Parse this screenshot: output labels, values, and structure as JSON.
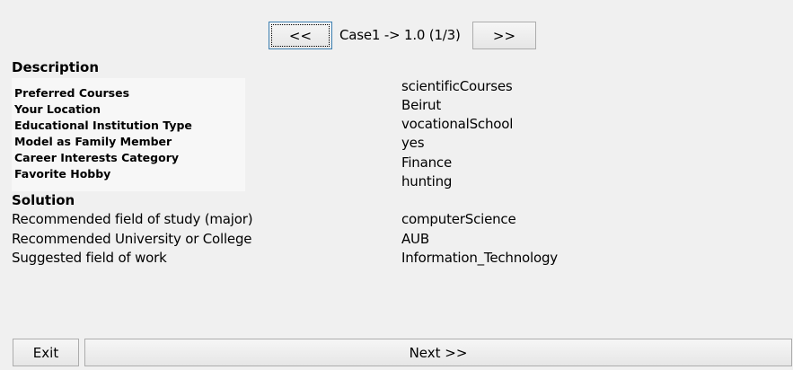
{
  "navigation": {
    "prev_label": "<<",
    "next_label": ">>",
    "case_indicator": "Case1 -> 1.0 (1/3)"
  },
  "description": {
    "title": "Description",
    "fields": [
      {
        "label": "Preferred Courses",
        "value": "scientificCourses"
      },
      {
        "label": "Your Location",
        "value": "Beirut"
      },
      {
        "label": "Educational Institution Type",
        "value": "vocationalSchool"
      },
      {
        "label": "Model as Family Member",
        "value": "yes"
      },
      {
        "label": "Career Interests Category",
        "value": "Finance"
      },
      {
        "label": "Favorite Hobby",
        "value": "hunting"
      }
    ]
  },
  "solution": {
    "title": "Solution",
    "fields": [
      {
        "label": "Recommended field of study (major)",
        "value": "computerScience"
      },
      {
        "label": "Recommended University or College",
        "value": "AUB"
      },
      {
        "label": "Suggested field of work",
        "value": "Information_Technology"
      }
    ]
  },
  "footer": {
    "exit_label": "Exit",
    "next_label": "Next >>"
  }
}
